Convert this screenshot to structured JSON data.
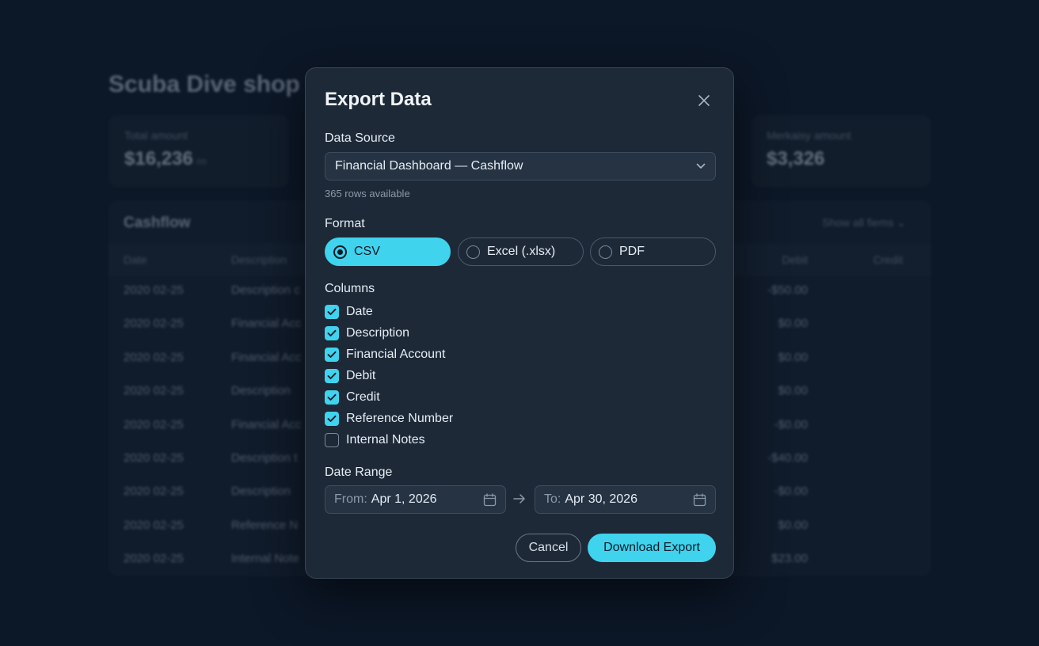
{
  "background": {
    "title": "Scuba Dive shop",
    "stats": [
      {
        "label": "Total amount",
        "value": "$16,236",
        "suffix": "/m"
      },
      {
        "label": "Merkaisy amount",
        "value": "$3,326",
        "suffix": ""
      }
    ],
    "table": {
      "title": "Cashflow",
      "filter": "Show all fiems ⌄",
      "columns": [
        "Date",
        "Description",
        "Debit",
        "Credit"
      ],
      "rows": [
        {
          "date": "2020 02-25",
          "desc": "Description c",
          "debit": "-$50.00"
        },
        {
          "date": "2020 02-25",
          "desc": "Financial Acc",
          "debit": "$0.00"
        },
        {
          "date": "2020 02-25",
          "desc": "Financial Acc",
          "debit": "$0.00"
        },
        {
          "date": "2020 02-25",
          "desc": "Description",
          "debit": "$0.00"
        },
        {
          "date": "2020 02-25",
          "desc": "Financial Acc",
          "debit": "-$0.00"
        },
        {
          "date": "2020 02-25",
          "desc": "Description t",
          "debit": "-$40.00"
        },
        {
          "date": "2020 02-25",
          "desc": "Description",
          "debit": "-$0.00"
        },
        {
          "date": "2020 02-25",
          "desc": "Reference N",
          "debit": "$0.00"
        },
        {
          "date": "2020 02-25",
          "desc": "Internal Note",
          "debit": "$23.00"
        }
      ]
    }
  },
  "modal": {
    "title": "Export Data",
    "data_source": {
      "label": "Data Source",
      "value": "Financial Dashboard — Cashflow",
      "note": "365 rows available"
    },
    "format": {
      "label": "Format",
      "options": [
        {
          "label": "CSV",
          "selected": true
        },
        {
          "label": "Excel (.xlsx)",
          "selected": false
        },
        {
          "label": "PDF",
          "selected": false
        }
      ]
    },
    "columns": {
      "label": "Columns",
      "items": [
        {
          "label": "Date",
          "checked": true
        },
        {
          "label": "Description",
          "checked": true
        },
        {
          "label": "Financial Account",
          "checked": true
        },
        {
          "label": "Debit",
          "checked": true
        },
        {
          "label": "Credit",
          "checked": true
        },
        {
          "label": "Reference Number",
          "checked": true
        },
        {
          "label": "Internal Notes",
          "checked": false
        }
      ]
    },
    "date_range": {
      "label": "Date Range",
      "from_prefix": "From:",
      "from_value": "Apr 1, 2026",
      "to_prefix": "To:",
      "to_value": "Apr 30, 2026"
    },
    "actions": {
      "cancel": "Cancel",
      "download": "Download Export"
    }
  },
  "colors": {
    "accent": "#3fd3ee",
    "modal_bg": "#1d2937",
    "page_bg": "#0c1727"
  }
}
